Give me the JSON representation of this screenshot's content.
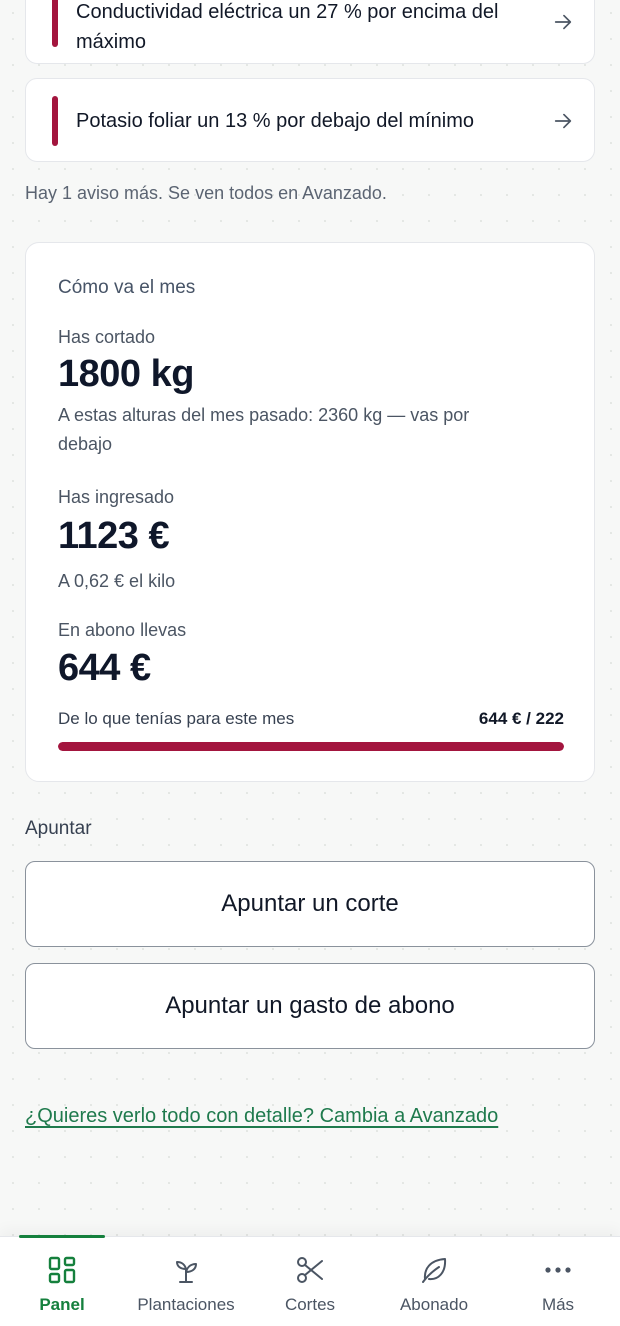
{
  "alerts": [
    {
      "text": "Conductividad eléctrica un 27 % por encima del máximo",
      "icon": "arrow-right-icon"
    },
    {
      "text": "Potasio foliar un 13 % por debajo del mínimo",
      "icon": "arrow-right-icon"
    }
  ],
  "more_note": "Hay 1 aviso más. Se ven todos en Avanzado.",
  "month": {
    "title": "Cómo va el mes",
    "cut_label": "Has cortado",
    "cut_value": "1800 kg",
    "cut_compare": "A estas alturas del mes pasado: 2360 kg — vas por debajo",
    "income_label": "Has ingresado",
    "income_value": "1123 €",
    "income_sub": "A 0,62 € el kilo",
    "fert_label": "En abono llevas",
    "fert_value": "644 €",
    "budget_label": "De lo que tenías para este mes",
    "budget_amount": "644 € / 222",
    "budget_fraction": 1.0
  },
  "actions": {
    "section_title": "Apuntar",
    "cut_button": "Apuntar un corte",
    "fert_button": "Apuntar un gasto de abono"
  },
  "advanced_link": "¿Quieres verlo todo con detalle? Cambia a Avanzado",
  "nav": [
    {
      "label": "Panel",
      "icon": "dashboard-icon",
      "active": true
    },
    {
      "label": "Plantaciones",
      "icon": "sprout-icon",
      "active": false
    },
    {
      "label": "Cortes",
      "icon": "scissors-icon",
      "active": false
    },
    {
      "label": "Abonado",
      "icon": "leaf-icon",
      "active": false
    },
    {
      "label": "Más",
      "icon": "more-icon",
      "active": false
    }
  ],
  "colors": {
    "accent_green": "#15803d",
    "alert_red": "#a3153e",
    "link_green": "#1f7a4d"
  }
}
